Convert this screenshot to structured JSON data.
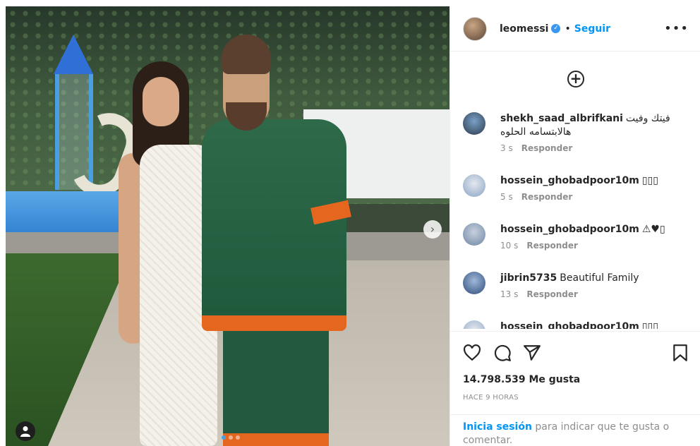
{
  "post": {
    "photo_alt": "",
    "carousel": {
      "count": 3,
      "active_index": 0
    }
  },
  "header": {
    "username": "leomessi",
    "verified_icon": "verified-badge-icon",
    "separator": "•",
    "follow_label": "Seguir",
    "more_icon": "more-options-icon",
    "more_glyph": "•••"
  },
  "add_comment": {
    "icon": "plus-circle-icon",
    "glyph": "+"
  },
  "comments": [
    {
      "user": "shekh_saad_albrifkani",
      "text": "فيتك وفيت هالابتسامه الحلوه",
      "time": "3 s",
      "reply": "Responder"
    },
    {
      "user": "hossein_ghobadpoor10m",
      "text": "▯▯▯",
      "time": "5 s",
      "reply": "Responder"
    },
    {
      "user": "hossein_ghobadpoor10m",
      "text": "⚠♥▯",
      "time": "10 s",
      "reply": "Responder"
    },
    {
      "user": "jibrin5735",
      "text": "Beautiful Family",
      "time": "13 s",
      "reply": "Responder"
    },
    {
      "user": "hossein_ghobadpoor10m",
      "text": "▯▯▯",
      "time": "",
      "reply": ""
    }
  ],
  "actions": {
    "like_icon": "heart-icon",
    "comment_icon": "comment-bubble-icon",
    "share_icon": "paper-plane-icon",
    "save_icon": "bookmark-icon"
  },
  "likes_text": "14.798.539 Me gusta",
  "time_text": "HACE 9 HORAS",
  "login": {
    "link_label": "Inicia sesión",
    "rest_text": " para indicar que te gusta o comentar."
  },
  "colors": {
    "accent": "#0095f6",
    "text": "#262626",
    "muted": "#8e8e8e"
  }
}
